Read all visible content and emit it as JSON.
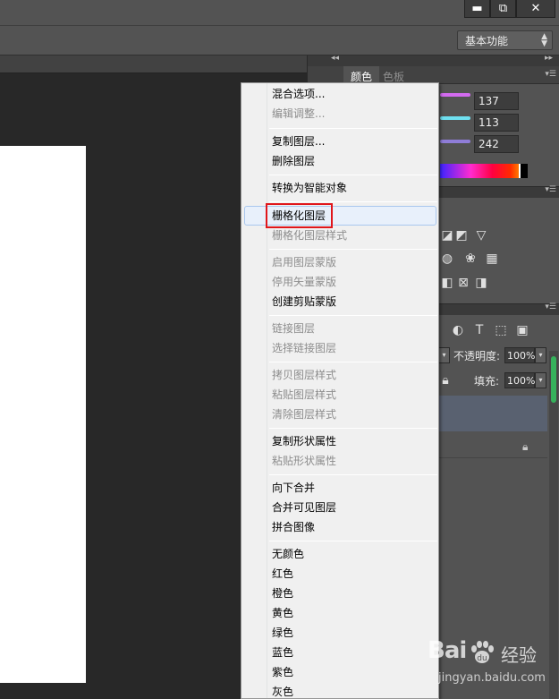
{
  "window": {
    "minimize_glyph": "▬",
    "restore_glyph": "⧉",
    "close_glyph": "✕"
  },
  "options_bar": {
    "workspace": "基本功能"
  },
  "color_panel": {
    "tabs": [
      "颜色",
      "色板"
    ],
    "active_tab": "颜色",
    "values": [
      "137",
      "113",
      "242"
    ],
    "slider_colors": [
      "#d36bf0",
      "#6fe0f0",
      "#8f7dd8"
    ]
  },
  "layers_panel": {
    "opacity_label": "不透明度:",
    "opacity_value": "100%",
    "fill_label": "填充:",
    "fill_value": "100%"
  },
  "context_menu": {
    "items": [
      {
        "label": "混合选项...",
        "enabled": true
      },
      {
        "label": "编辑调整...",
        "enabled": false
      },
      {
        "label": "复制图层...",
        "enabled": true
      },
      {
        "label": "删除图层",
        "enabled": true
      },
      {
        "label": "转换为智能对象",
        "enabled": true
      },
      {
        "label": "栅格化图层",
        "enabled": true,
        "highlighted": true
      },
      {
        "label": "栅格化图层样式",
        "enabled": false
      },
      {
        "label": "启用图层蒙版",
        "enabled": false
      },
      {
        "label": "停用矢量蒙版",
        "enabled": false
      },
      {
        "label": "创建剪贴蒙版",
        "enabled": true
      },
      {
        "label": "链接图层",
        "enabled": false
      },
      {
        "label": "选择链接图层",
        "enabled": false
      },
      {
        "label": "拷贝图层样式",
        "enabled": false
      },
      {
        "label": "粘贴图层样式",
        "enabled": false
      },
      {
        "label": "清除图层样式",
        "enabled": false
      },
      {
        "label": "复制形状属性",
        "enabled": true
      },
      {
        "label": "粘贴形状属性",
        "enabled": false
      },
      {
        "label": "向下合并",
        "enabled": true
      },
      {
        "label": "合并可见图层",
        "enabled": true
      },
      {
        "label": "拼合图像",
        "enabled": true
      },
      {
        "label": "无颜色",
        "enabled": true
      },
      {
        "label": "红色",
        "enabled": true
      },
      {
        "label": "橙色",
        "enabled": true
      },
      {
        "label": "黄色",
        "enabled": true
      },
      {
        "label": "绿色",
        "enabled": true
      },
      {
        "label": "蓝色",
        "enabled": true
      },
      {
        "label": "紫色",
        "enabled": true
      },
      {
        "label": "灰色",
        "enabled": true
      }
    ]
  },
  "watermark": {
    "logo": "Bai",
    "logo_suffix": "经验",
    "url": "jingyan.baidu.com"
  }
}
